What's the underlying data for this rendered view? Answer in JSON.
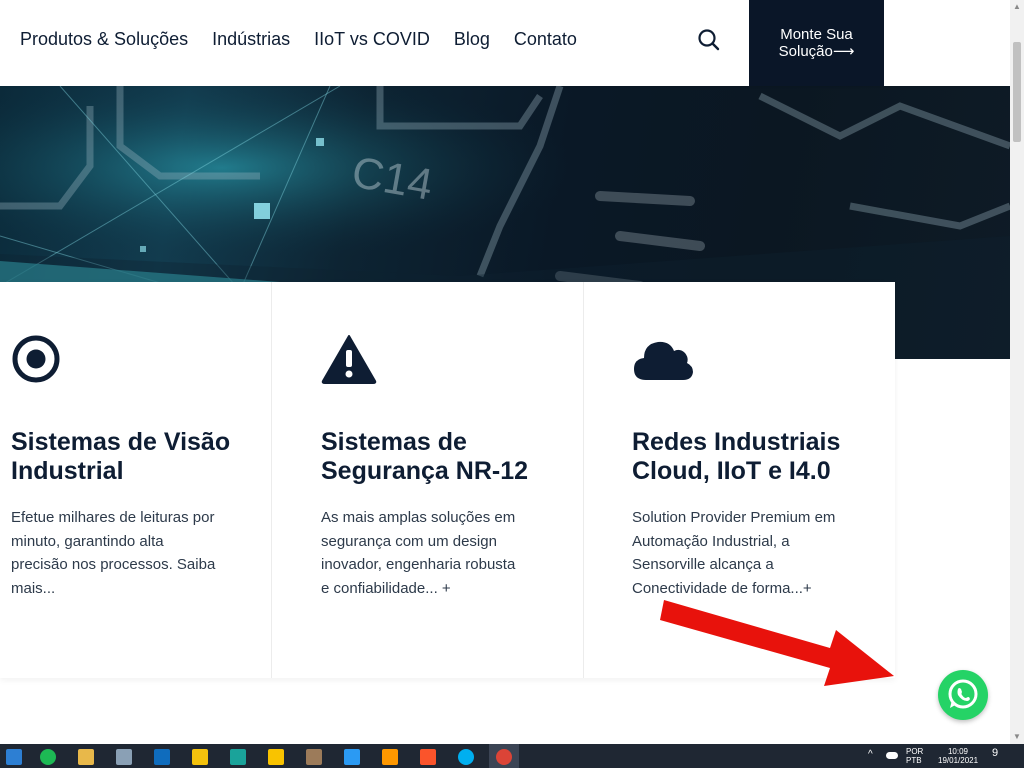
{
  "nav": {
    "links": [
      "Produtos & Soluções",
      "Indústrias",
      "IIoT vs COVID",
      "Blog",
      "Contato"
    ],
    "cta_line1": "Monte Sua",
    "cta_line2": "Solução⟶"
  },
  "cards": [
    {
      "icon": "target-icon",
      "title": "Sistemas de Visão Industrial",
      "text": "Efetue milhares de leituras por minuto, garantindo alta precisão nos processos. Saiba mais..."
    },
    {
      "icon": "warning-icon",
      "title": "Sistemas de Segurança NR-12",
      "text": "As mais amplas soluções em segurança com um design inovador, engenharia robusta e confiabilidade... +"
    },
    {
      "icon": "cloud-icon",
      "title": "Redes Industriais Cloud, IIoT e I4.0",
      "text": "Solution Provider Premium em Automação Industrial, a Sensorville alcança a Conectividade de forma...+"
    }
  ],
  "hero": {
    "chip_label": "C14"
  },
  "taskbar": {
    "lang_line1": "POR",
    "lang_line2": "PTB",
    "time": "10:09",
    "date": "19/01/2021",
    "notification_count": "9"
  },
  "colors": {
    "navy": "#0a1628",
    "whatsapp": "#25d366",
    "arrow": "#e8120c"
  }
}
